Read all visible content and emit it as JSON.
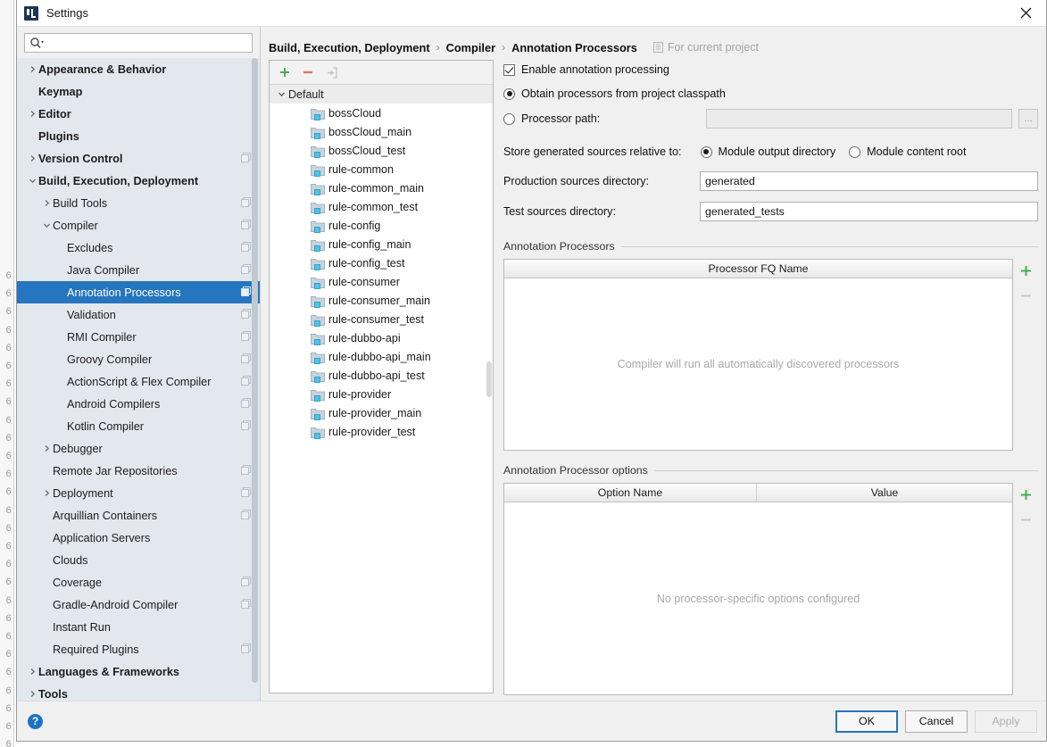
{
  "window": {
    "title": "Settings",
    "app_icon": "intellij-idea-icon",
    "close_icon": "close-icon"
  },
  "search": {
    "value": "",
    "placeholder": "",
    "icon": "search-icon"
  },
  "sidebar": {
    "items": [
      {
        "label": "Appearance & Behavior",
        "indent": 0,
        "arrow": "right",
        "bold": true,
        "badge": false,
        "selected": false
      },
      {
        "label": "Keymap",
        "indent": 0,
        "arrow": "none",
        "bold": true,
        "badge": false,
        "selected": false
      },
      {
        "label": "Editor",
        "indent": 0,
        "arrow": "right",
        "bold": true,
        "badge": false,
        "selected": false
      },
      {
        "label": "Plugins",
        "indent": 0,
        "arrow": "none",
        "bold": true,
        "badge": false,
        "selected": false
      },
      {
        "label": "Version Control",
        "indent": 0,
        "arrow": "right",
        "bold": true,
        "badge": true,
        "selected": false
      },
      {
        "label": "Build, Execution, Deployment",
        "indent": 0,
        "arrow": "down",
        "bold": true,
        "badge": false,
        "selected": false
      },
      {
        "label": "Build Tools",
        "indent": 1,
        "arrow": "right",
        "bold": false,
        "badge": true,
        "selected": false
      },
      {
        "label": "Compiler",
        "indent": 1,
        "arrow": "down",
        "bold": false,
        "badge": true,
        "selected": false
      },
      {
        "label": "Excludes",
        "indent": 2,
        "arrow": "none",
        "bold": false,
        "badge": true,
        "selected": false
      },
      {
        "label": "Java Compiler",
        "indent": 2,
        "arrow": "none",
        "bold": false,
        "badge": true,
        "selected": false
      },
      {
        "label": "Annotation Processors",
        "indent": 2,
        "arrow": "none",
        "bold": false,
        "badge": true,
        "selected": true
      },
      {
        "label": "Validation",
        "indent": 2,
        "arrow": "none",
        "bold": false,
        "badge": true,
        "selected": false
      },
      {
        "label": "RMI Compiler",
        "indent": 2,
        "arrow": "none",
        "bold": false,
        "badge": true,
        "selected": false
      },
      {
        "label": "Groovy Compiler",
        "indent": 2,
        "arrow": "none",
        "bold": false,
        "badge": true,
        "selected": false
      },
      {
        "label": "ActionScript & Flex Compiler",
        "indent": 2,
        "arrow": "none",
        "bold": false,
        "badge": true,
        "selected": false
      },
      {
        "label": "Android Compilers",
        "indent": 2,
        "arrow": "none",
        "bold": false,
        "badge": true,
        "selected": false
      },
      {
        "label": "Kotlin Compiler",
        "indent": 2,
        "arrow": "none",
        "bold": false,
        "badge": true,
        "selected": false
      },
      {
        "label": "Debugger",
        "indent": 1,
        "arrow": "right",
        "bold": false,
        "badge": false,
        "selected": false
      },
      {
        "label": "Remote Jar Repositories",
        "indent": 1,
        "arrow": "none",
        "bold": false,
        "badge": true,
        "selected": false
      },
      {
        "label": "Deployment",
        "indent": 1,
        "arrow": "right",
        "bold": false,
        "badge": true,
        "selected": false
      },
      {
        "label": "Arquillian Containers",
        "indent": 1,
        "arrow": "none",
        "bold": false,
        "badge": true,
        "selected": false
      },
      {
        "label": "Application Servers",
        "indent": 1,
        "arrow": "none",
        "bold": false,
        "badge": false,
        "selected": false
      },
      {
        "label": "Clouds",
        "indent": 1,
        "arrow": "none",
        "bold": false,
        "badge": false,
        "selected": false
      },
      {
        "label": "Coverage",
        "indent": 1,
        "arrow": "none",
        "bold": false,
        "badge": true,
        "selected": false
      },
      {
        "label": "Gradle-Android Compiler",
        "indent": 1,
        "arrow": "none",
        "bold": false,
        "badge": true,
        "selected": false
      },
      {
        "label": "Instant Run",
        "indent": 1,
        "arrow": "none",
        "bold": false,
        "badge": false,
        "selected": false
      },
      {
        "label": "Required Plugins",
        "indent": 1,
        "arrow": "none",
        "bold": false,
        "badge": true,
        "selected": false
      },
      {
        "label": "Languages & Frameworks",
        "indent": 0,
        "arrow": "right",
        "bold": true,
        "badge": false,
        "selected": false
      },
      {
        "label": "Tools",
        "indent": 0,
        "arrow": "right",
        "bold": true,
        "badge": false,
        "selected": false
      }
    ]
  },
  "breadcrumb": {
    "parts": [
      "Build, Execution, Deployment",
      "Compiler",
      "Annotation Processors"
    ],
    "separator": "›",
    "scope_label": "For current project",
    "scope_icon": "project-scope-icon"
  },
  "modules": {
    "toolbar": [
      {
        "name": "add-module-button",
        "icon": "plus-icon",
        "enabled": true
      },
      {
        "name": "remove-module-button",
        "icon": "minus-icon",
        "enabled": true
      },
      {
        "name": "move-to-profile-button",
        "icon": "move-to-icon",
        "enabled": false
      }
    ],
    "group_label": "Default",
    "items": [
      "bossCloud",
      "bossCloud_main",
      "bossCloud_test",
      "rule-common",
      "rule-common_main",
      "rule-common_test",
      "rule-config",
      "rule-config_main",
      "rule-config_test",
      "rule-consumer",
      "rule-consumer_main",
      "rule-consumer_test",
      "rule-dubbo-api",
      "rule-dubbo-api_main",
      "rule-dubbo-api_test",
      "rule-provider",
      "rule-provider_main",
      "rule-provider_test"
    ]
  },
  "form": {
    "enable_label": "Enable annotation processing",
    "enable_checked": true,
    "obtain_label": "Obtain processors from project classpath",
    "obtain_selected": true,
    "processor_path_label": "Processor path:",
    "processor_path_selected": false,
    "processor_path_value": "",
    "browse_label": "...",
    "store_label": "Store generated sources relative to:",
    "store_options": [
      {
        "label": "Module output directory",
        "selected": true
      },
      {
        "label": "Module content root",
        "selected": false
      }
    ],
    "production_label": "Production sources directory:",
    "production_value": "generated",
    "test_label": "Test sources directory:",
    "test_value": "generated_tests"
  },
  "processors_table": {
    "section_title": "Annotation Processors",
    "columns": [
      "Processor FQ Name"
    ],
    "rows": [],
    "empty_text": "Compiler will run all automatically discovered processors",
    "add_icon": "plus-icon",
    "remove_icon": "minus-icon"
  },
  "options_table": {
    "section_title": "Annotation Processor options",
    "columns": [
      "Option Name",
      "Value"
    ],
    "rows": [],
    "empty_text": "No processor-specific options configured",
    "add_icon": "plus-icon",
    "remove_icon": "minus-icon"
  },
  "footer": {
    "help_icon": "help-icon",
    "help_label": "?",
    "ok_label": "OK",
    "cancel_label": "Cancel",
    "apply_label": "Apply",
    "apply_enabled": false
  },
  "colors": {
    "selection_blue": "#2675bf",
    "sidebar_bg": "#e3e8ef",
    "dialog_bg": "#f0f0f0",
    "accent_green": "#4caf50",
    "accent_red": "#d9737e",
    "help_blue": "#1a73c4"
  },
  "background_ide": {
    "gutter_line_number": "6"
  }
}
